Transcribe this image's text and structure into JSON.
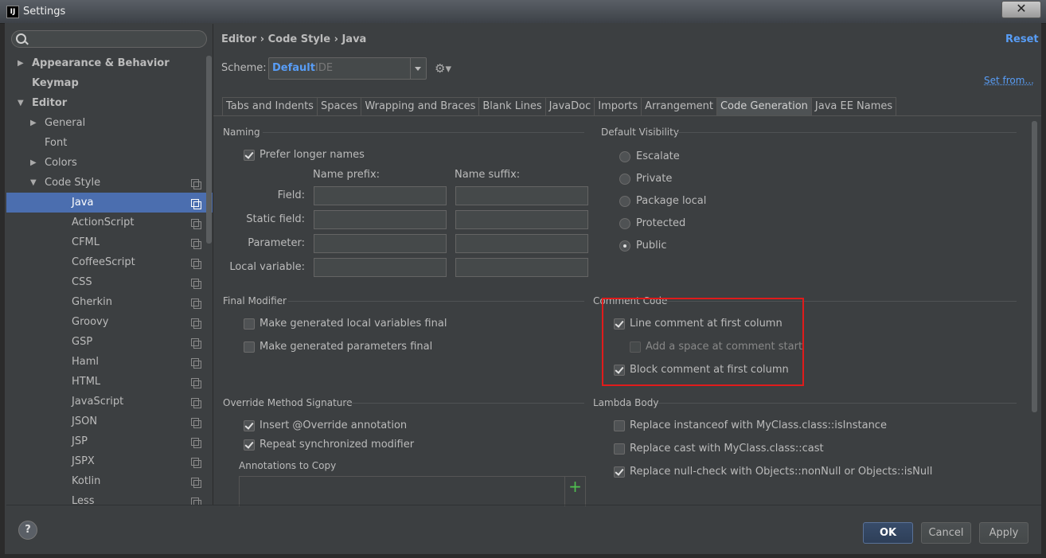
{
  "window": {
    "title": "Settings",
    "close": "✕"
  },
  "search": {
    "placeholder": "",
    "value": ""
  },
  "tree": [
    {
      "label": "Appearance & Behavior",
      "bold": true,
      "arrow": "right",
      "indent": 0
    },
    {
      "label": "Keymap",
      "bold": true,
      "arrow": "none",
      "indent": 0
    },
    {
      "label": "Editor",
      "bold": true,
      "arrow": "down",
      "indent": 0
    },
    {
      "label": "General",
      "arrow": "right",
      "indent": 1
    },
    {
      "label": "Font",
      "arrow": "none",
      "indent": 1
    },
    {
      "label": "Colors",
      "arrow": "right",
      "indent": 1
    },
    {
      "label": "Code Style",
      "arrow": "down",
      "indent": 1,
      "copy": true
    },
    {
      "label": "Java",
      "indent": 2,
      "copy": true,
      "selected": true
    },
    {
      "label": "ActionScript",
      "indent": 2,
      "copy": true
    },
    {
      "label": "CFML",
      "indent": 2,
      "copy": true
    },
    {
      "label": "CoffeeScript",
      "indent": 2,
      "copy": true
    },
    {
      "label": "CSS",
      "indent": 2,
      "copy": true
    },
    {
      "label": "Gherkin",
      "indent": 2,
      "copy": true
    },
    {
      "label": "Groovy",
      "indent": 2,
      "copy": true
    },
    {
      "label": "GSP",
      "indent": 2,
      "copy": true
    },
    {
      "label": "Haml",
      "indent": 2,
      "copy": true
    },
    {
      "label": "HTML",
      "indent": 2,
      "copy": true
    },
    {
      "label": "JavaScript",
      "indent": 2,
      "copy": true
    },
    {
      "label": "JSON",
      "indent": 2,
      "copy": true
    },
    {
      "label": "JSP",
      "indent": 2,
      "copy": true
    },
    {
      "label": "JSPX",
      "indent": 2,
      "copy": true
    },
    {
      "label": "Kotlin",
      "indent": 2,
      "copy": true
    },
    {
      "label": "Less",
      "indent": 2,
      "copy": true
    }
  ],
  "header": {
    "breadcrumb": "Editor › Code Style › Java",
    "reset": "Reset",
    "set_from": "Set from..."
  },
  "scheme": {
    "label": "Scheme:",
    "value": "Default",
    "sub": "IDE"
  },
  "tabs": [
    "Tabs and Indents",
    "Spaces",
    "Wrapping and Braces",
    "Blank Lines",
    "JavaDoc",
    "Imports",
    "Arrangement",
    "Code Generation",
    "Java EE Names"
  ],
  "active_tab": "Code Generation",
  "naming": {
    "title": "Naming",
    "prefer_longer": "Prefer longer names",
    "prefix_header": "Name prefix:",
    "suffix_header": "Name suffix:",
    "rows": [
      "Field:",
      "Static field:",
      "Parameter:",
      "Local variable:"
    ]
  },
  "visibility": {
    "title": "Default Visibility",
    "options": [
      "Escalate",
      "Private",
      "Package local",
      "Protected",
      "Public"
    ],
    "selected": "Public"
  },
  "final_modifier": {
    "title": "Final Modifier",
    "local_vars": "Make generated local variables final",
    "params": "Make generated parameters final"
  },
  "comment_code": {
    "title": "Comment Code",
    "line_first_col": "Line comment at first column",
    "add_space": "Add a space at comment start",
    "block_first_col": "Block comment at first column"
  },
  "override": {
    "title": "Override Method Signature",
    "insert_override": "Insert @Override annotation",
    "repeat_sync": "Repeat synchronized modifier",
    "annotations": "Annotations to Copy",
    "add_symbol": "+"
  },
  "lambda": {
    "title": "Lambda Body",
    "instanceof": "Replace instanceof with MyClass.class::isInstance",
    "cast": "Replace cast with MyClass.class::cast",
    "nullcheck": "Replace null-check with Objects::nonNull or Objects::isNull"
  },
  "buttons": {
    "help": "?",
    "ok": "OK",
    "cancel": "Cancel",
    "apply": "Apply"
  },
  "colors": {
    "accent": "#589df6",
    "selection": "#4b6eaf",
    "highlight_box": "#e01b1b"
  }
}
